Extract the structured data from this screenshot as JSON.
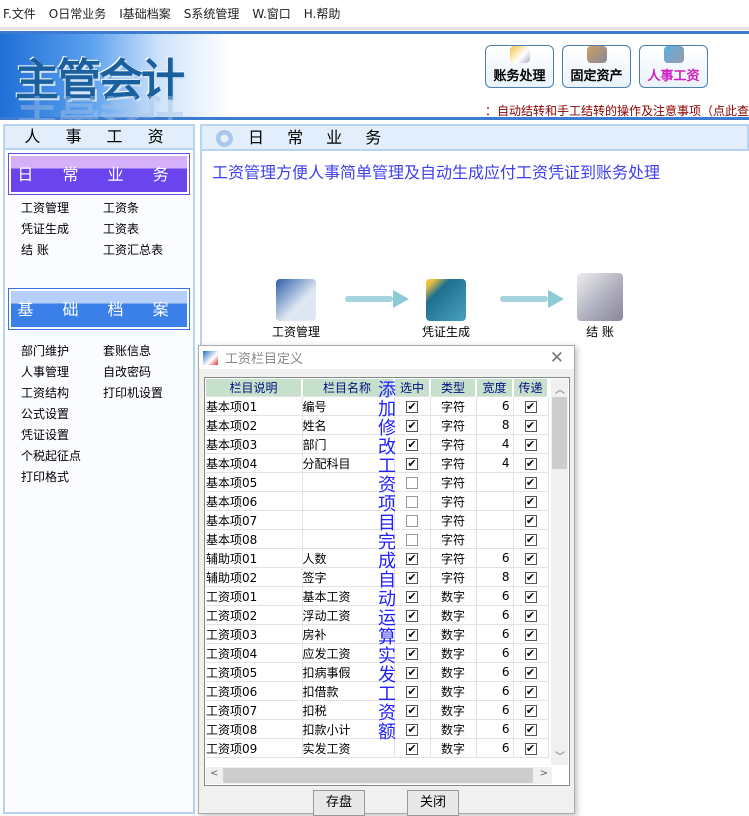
{
  "menu": [
    "F.文件",
    "O日常业务",
    "I基础档案",
    "S系统管理",
    "W.窗口",
    "H.帮助"
  ],
  "banner": {
    "logo": "主管会计",
    "modules": [
      {
        "label": "账务处理",
        "color": "#000000"
      },
      {
        "label": "固定资产",
        "color": "#000000"
      },
      {
        "label": "人事工资",
        "color": "#d020c0"
      }
    ],
    "notice": "：自动结转和手工结转的操作及注意事项（点此查"
  },
  "left": {
    "title": "人 事 工 资",
    "daily": {
      "title": "日 常 业 务",
      "items": [
        "工资管理",
        "工资条",
        "凭证生成",
        "工资表",
        "结 账",
        "工资汇总表"
      ]
    },
    "base": {
      "title": "基 础 档 案",
      "items": [
        "部门维护",
        "套账信息",
        "人事管理",
        "自改密码",
        "工资结构",
        "打印机设置",
        "公式设置",
        "",
        "凭证设置",
        "",
        "个税起征点",
        "",
        "打印格式",
        ""
      ]
    }
  },
  "main": {
    "title": "日 常 业 务",
    "description": "工资管理方便人事简单管理及自动生成应付工资凭证到账务处理",
    "flow": [
      "工资管理",
      "凭证生成",
      "结 账"
    ]
  },
  "dialog": {
    "title": "工资栏目定义",
    "overlay_text": "添加修改工资项目完成自动运算实发工资额",
    "columns": [
      "栏目说明",
      "栏目名称",
      "选中",
      "类型",
      "宽度",
      "传递"
    ],
    "rows": [
      [
        "基本项01",
        "编号",
        true,
        "字符",
        "6",
        true
      ],
      [
        "基本项02",
        "姓名",
        true,
        "字符",
        "8",
        true
      ],
      [
        "基本项03",
        "部门",
        true,
        "字符",
        "4",
        true
      ],
      [
        "基本项04",
        "分配科目",
        true,
        "字符",
        "4",
        true
      ],
      [
        "基本项05",
        "",
        false,
        "字符",
        "",
        true
      ],
      [
        "基本项06",
        "",
        false,
        "字符",
        "",
        true
      ],
      [
        "基本项07",
        "",
        false,
        "字符",
        "",
        true
      ],
      [
        "基本项08",
        "",
        false,
        "字符",
        "",
        true
      ],
      [
        "辅助项01",
        "人数",
        true,
        "字符",
        "6",
        true
      ],
      [
        "辅助项02",
        "签字",
        true,
        "字符",
        "8",
        true
      ],
      [
        "工资项01",
        "基本工资",
        true,
        "数字",
        "6",
        true
      ],
      [
        "工资项02",
        "浮动工资",
        true,
        "数字",
        "6",
        true
      ],
      [
        "工资项03",
        "房补",
        true,
        "数字",
        "6",
        true
      ],
      [
        "工资项04",
        "应发工资",
        true,
        "数字",
        "6",
        true
      ],
      [
        "工资项05",
        "扣病事假",
        true,
        "数字",
        "6",
        true
      ],
      [
        "工资项06",
        "扣借款",
        true,
        "数字",
        "6",
        true
      ],
      [
        "工资项07",
        "扣税",
        true,
        "数字",
        "6",
        true
      ],
      [
        "工资项08",
        "扣款小计",
        true,
        "数字",
        "6",
        true
      ],
      [
        "工资项09",
        "实发工资",
        true,
        "数字",
        "6",
        true
      ]
    ],
    "save_label": "存盘",
    "close_label": "关闭"
  }
}
